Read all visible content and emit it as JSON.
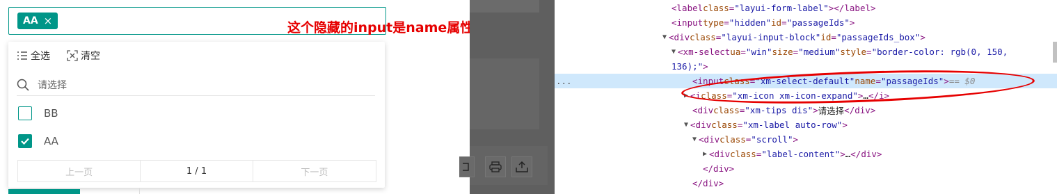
{
  "select": {
    "tag_label": "AA",
    "tag_close": "×",
    "toolbar": {
      "select_all": "全选",
      "clear": "清空"
    },
    "search_placeholder": "请选择",
    "options": [
      {
        "label": "BB",
        "checked": false
      },
      {
        "label": "AA",
        "checked": true
      }
    ],
    "pager": {
      "prev": "上一页",
      "page": "1 / 1",
      "next": "下一页"
    }
  },
  "annotation": "这个隐藏的input是name属性添加的",
  "devtools": {
    "lines": [
      {
        "html": "<span class='t'>&lt;label</span> <span class='a'>class</span><span class='t'>=</span><span class='v'>\"layui-form-label\"</span><span class='t'>&gt;</span>        <span class='t'>&lt;/label&gt;</span>"
      },
      {
        "html": "<span class='t'>&lt;input</span> <span class='a'>type</span><span class='t'>=</span><span class='v'>\"hidden\"</span> <span class='a'>id</span><span class='t'>=</span><span class='v'>\"passageIds\"</span><span class='t'>&gt;</span>"
      },
      {
        "html": "<span class='tri'>▼</span><span class='t'>&lt;div</span> <span class='a'>class</span><span class='t'>=</span><span class='v'>\"layui-input-block\"</span> <span class='a'>id</span><span class='t'>=</span><span class='v'>\"passageIds_box\"</span><span class='t'>&gt;</span>"
      },
      {
        "html": "<span class='tri'>▼</span><span class='t'>&lt;xm-select</span> <span class='a'>ua</span><span class='t'>=</span><span class='v'>\"win\"</span> <span class='a'>size</span><span class='t'>=</span><span class='v'>\"medium\"</span> <span class='a'>style</span><span class='t'>=</span><span class='v'>\"border-color: rgb(0, 150,</span>"
      },
      {
        "html": "<span class='v'>136);\"</span><span class='t'>&gt;</span>"
      },
      {
        "html": "<span class='t'>&lt;input</span> <span class='a'>class</span><span class='t'>=</span><span class='v'>\"xm-select-default\"</span> <span class='a'>name</span><span class='t'>=</span><span class='v'>\"passageIds\"</span><span class='t'>&gt;</span> <span class='c'>== $0</span>"
      },
      {
        "html": "<span class='tri'>▶</span><span class='t'>&lt;i</span> <span class='a'>class</span><span class='t'>=</span><span class='v'>\"xm-icon xm-icon-expand\"</span><span class='t'>&gt;</span>…<span class='t'>&lt;/i&gt;</span>"
      },
      {
        "html": "<span class='t'>&lt;div</span> <span class='a'>class</span><span class='t'>=</span><span class='v'>\"xm-tips dis\"</span><span class='t'>&gt;</span><span class='p'>请选择</span><span class='t'>&lt;/div&gt;</span>"
      },
      {
        "html": "<span class='tri'>▼</span><span class='t'>&lt;div</span> <span class='a'>class</span><span class='t'>=</span><span class='v'>\"xm-label auto-row\"</span><span class='t'>&gt;</span>"
      },
      {
        "html": "<span class='tri'>▼</span><span class='t'>&lt;div</span> <span class='a'>class</span><span class='t'>=</span><span class='v'>\"scroll\"</span><span class='t'>&gt;</span>"
      },
      {
        "html": "<span class='tri'>▶</span><span class='t'>&lt;div</span> <span class='a'>class</span><span class='t'>=</span><span class='v'>\"label-content\"</span><span class='t'>&gt;</span>…<span class='t'>&lt;/div&gt;</span>"
      },
      {
        "html": "<span class='t'>&lt;/div&gt;</span>"
      },
      {
        "html": "<span class='t'>&lt;/div&gt;</span>"
      }
    ],
    "gutter": "...",
    "colors": {
      "tag": "#009688",
      "highlight": "#cfe8fc",
      "annotation": "#e60000"
    }
  }
}
